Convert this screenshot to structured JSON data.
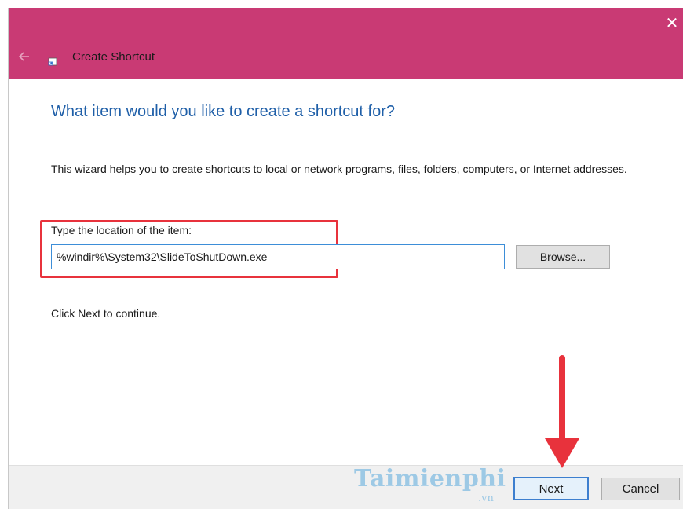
{
  "window": {
    "title": "Create Shortcut",
    "close_glyph": "✕"
  },
  "content": {
    "heading": "What item would you like to create a shortcut for?",
    "description": "This wizard helps you to create shortcuts to local or network programs, files, folders, computers, or Internet addresses.",
    "location_label": "Type the location of the item:",
    "location_value": "%windir%\\System32\\SlideToShutDown.exe",
    "browse_label": "Browse...",
    "continue_text": "Click Next to continue."
  },
  "footer": {
    "next_label": "Next",
    "cancel_label": "Cancel"
  },
  "watermark": {
    "brand": "Taimienphi",
    "suffix": ".vn"
  },
  "icons": {
    "back": "back-arrow-icon",
    "app": "shortcut-icon",
    "close": "close-icon"
  },
  "colors": {
    "titlebar": "#c93a74",
    "heading": "#1f5fa8",
    "highlight": "#e8323c",
    "arrow": "#e8323c",
    "input_border": "#3d8ed8"
  }
}
